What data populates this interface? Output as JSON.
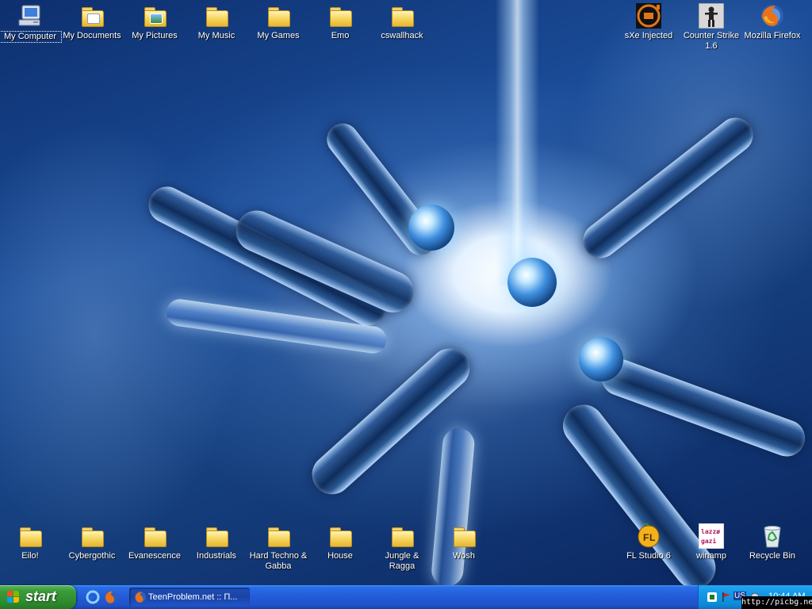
{
  "desktop": {
    "icons_top": [
      {
        "label": "My Computer",
        "type": "computer",
        "selected": true
      },
      {
        "label": "My Documents",
        "type": "special-folder"
      },
      {
        "label": "My Pictures",
        "type": "special-folder"
      },
      {
        "label": "My Music",
        "type": "folder"
      },
      {
        "label": "My Games",
        "type": "folder"
      },
      {
        "label": "Emo",
        "type": "folder"
      },
      {
        "label": "cswallhack",
        "type": "folder"
      }
    ],
    "icons_top_right": [
      {
        "label": "sXe Injected",
        "type": "app-sxe"
      },
      {
        "label": "Counter Strike 1.6",
        "type": "app-cs"
      },
      {
        "label": "Mozilla Firefox",
        "type": "app-firefox"
      }
    ],
    "icons_bottom": [
      {
        "label": "Eilo!",
        "type": "folder"
      },
      {
        "label": "Cybergothic",
        "type": "folder"
      },
      {
        "label": "Evanescence",
        "type": "folder"
      },
      {
        "label": "Industrials",
        "type": "folder"
      },
      {
        "label": "Hard Techno & Gabba",
        "type": "folder"
      },
      {
        "label": "House",
        "type": "folder"
      },
      {
        "label": "Jungle & Ragga",
        "type": "folder"
      },
      {
        "label": "Wosh",
        "type": "folder"
      }
    ],
    "icons_bottom_right": [
      {
        "label": "FL Studio 6",
        "type": "app-flstudio"
      },
      {
        "label": "winamp",
        "type": "app-winamp",
        "badge": "lazzø gazi"
      },
      {
        "label": "Recycle Bin",
        "type": "recycle-bin"
      }
    ]
  },
  "taskbar": {
    "start_label": "start",
    "quick_launch": [
      "ie-icon",
      "firefox-icon"
    ],
    "tasks": [
      {
        "label": "TeenProblem.net :: П...",
        "icon": "firefox-icon"
      }
    ],
    "tray": {
      "language": "US",
      "clock": "10:44 AM"
    }
  },
  "watermark": "http://picbg.net/",
  "colors": {
    "taskbar": "#245edb",
    "start_button": "#3a9b3a",
    "tray": "#149be8",
    "folder": "#f7d865"
  }
}
